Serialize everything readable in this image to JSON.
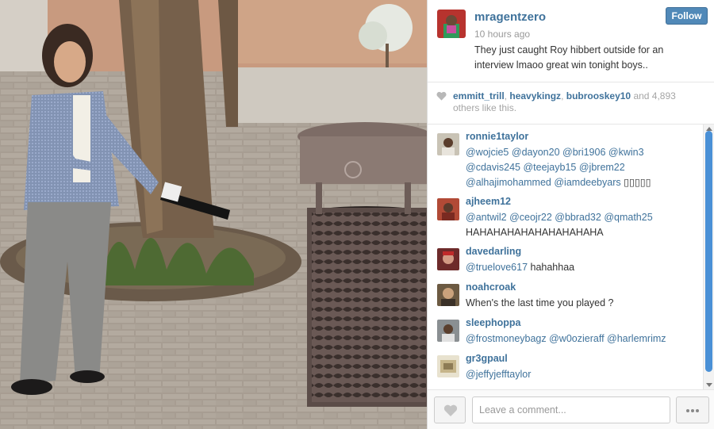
{
  "post": {
    "username": "mragentzero",
    "time": "10 hours ago",
    "caption": "They just caught Roy hibbert outside for an interview lmaoo great win tonight boys..",
    "follow_label": "Follow"
  },
  "likes": {
    "icon": "heart-icon",
    "users": [
      "emmitt_trill",
      "heavykingz",
      "bubrooskey10"
    ],
    "sep1": ", ",
    "sep2": ", ",
    "tail": " and 4,893 others like this."
  },
  "comments": [
    {
      "user": "ronnie1taylor",
      "lines": [
        {
          "segments": [
            {
              "t": "@wojcie5",
              "m": true
            },
            {
              "t": " "
            },
            {
              "t": "@dayon20",
              "m": true
            },
            {
              "t": " "
            },
            {
              "t": "@bri1906",
              "m": true
            },
            {
              "t": " "
            },
            {
              "t": "@kwin3",
              "m": true
            }
          ]
        },
        {
          "segments": [
            {
              "t": "@cdavis245",
              "m": true
            },
            {
              "t": " "
            },
            {
              "t": "@teejayb15",
              "m": true
            },
            {
              "t": " "
            },
            {
              "t": "@jbrem22",
              "m": true
            }
          ]
        },
        {
          "segments": [
            {
              "t": "@alhajimohammed",
              "m": true
            },
            {
              "t": " "
            },
            {
              "t": "@iamdeebyars",
              "m": true
            },
            {
              "t": " ▯▯▯▯▯"
            }
          ]
        }
      ]
    },
    {
      "user": "ajheem12",
      "lines": [
        {
          "segments": [
            {
              "t": "@antwil2",
              "m": true
            },
            {
              "t": " "
            },
            {
              "t": "@ceojr22",
              "m": true
            },
            {
              "t": " "
            },
            {
              "t": "@bbrad32",
              "m": true
            },
            {
              "t": " "
            },
            {
              "t": "@qmath25",
              "m": true
            }
          ]
        },
        {
          "segments": [
            {
              "t": "HAHAHAHAHAHAHAHAHAHA"
            }
          ]
        }
      ]
    },
    {
      "user": "davedarling",
      "lines": [
        {
          "segments": [
            {
              "t": "@truelove617",
              "m": true
            },
            {
              "t": " hahahhaa"
            }
          ]
        }
      ]
    },
    {
      "user": "noahcroak",
      "lines": [
        {
          "segments": [
            {
              "t": "When's the last time you played ?"
            }
          ]
        }
      ]
    },
    {
      "user": "sleephoppa",
      "lines": [
        {
          "segments": [
            {
              "t": "@frostmoneybagz",
              "m": true
            },
            {
              "t": " "
            },
            {
              "t": "@w0ozieraff",
              "m": true
            },
            {
              "t": " "
            },
            {
              "t": "@harlemrimz",
              "m": true
            }
          ]
        }
      ]
    },
    {
      "user": "gr3gpaul",
      "lines": [
        {
          "segments": [
            {
              "t": "@jeffyjefftaylor",
              "m": true
            }
          ]
        }
      ]
    }
  ],
  "footer": {
    "like_icon": "heart-icon",
    "comment_placeholder": "Leave a comment...",
    "more_icon": "ellipsis-icon"
  },
  "colors": {
    "link": "#3f729b",
    "follow_button": "#5189b8",
    "scroll_thumb": "#4a90d6"
  }
}
